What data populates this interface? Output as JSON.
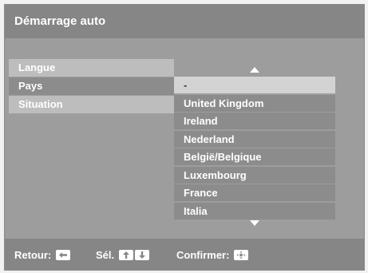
{
  "title": "Démarrage auto",
  "menu": [
    {
      "label": "Langue"
    },
    {
      "label": "Pays"
    },
    {
      "label": "Situation"
    }
  ],
  "options": [
    {
      "label": "-"
    },
    {
      "label": "United Kingdom"
    },
    {
      "label": "Ireland"
    },
    {
      "label": "Nederland"
    },
    {
      "label": "België/Belgique"
    },
    {
      "label": "Luxembourg"
    },
    {
      "label": "France"
    },
    {
      "label": "Italia"
    }
  ],
  "footer": {
    "back_label": "Retour:",
    "select_label": "Sél.",
    "confirm_label": "Confirmer:"
  },
  "icons": {
    "back": "left-arrow-icon",
    "up": "up-arrow-icon",
    "down": "down-arrow-icon",
    "confirm": "center-dpad-icon",
    "scroll_up": "scroll-up-icon",
    "scroll_down": "scroll-down-icon"
  },
  "colors": {
    "panel": "#9d9d9d",
    "bar": "#868686",
    "selected": "#8c8c8c",
    "unselected": "#bdbdbd",
    "highlight": "#d3d3d3"
  }
}
